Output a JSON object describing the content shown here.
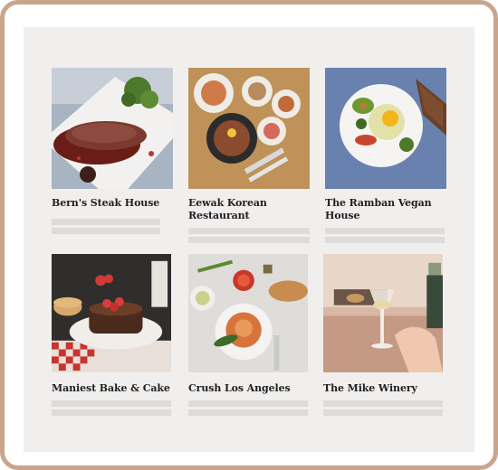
{
  "restaurants": [
    {
      "name": "Bern's Steak House",
      "image": "steak-plate"
    },
    {
      "name": "Eewak Korean Restaurant",
      "image": "korean-table"
    },
    {
      "name": "The Ramban Vegan House",
      "image": "vegan-plate"
    },
    {
      "name": "Maniest Bake & Cake",
      "image": "pancake-stack"
    },
    {
      "name": "Crush Los Angeles",
      "image": "pasta-table"
    },
    {
      "name": "The Mike Winery",
      "image": "wine-glass"
    }
  ]
}
